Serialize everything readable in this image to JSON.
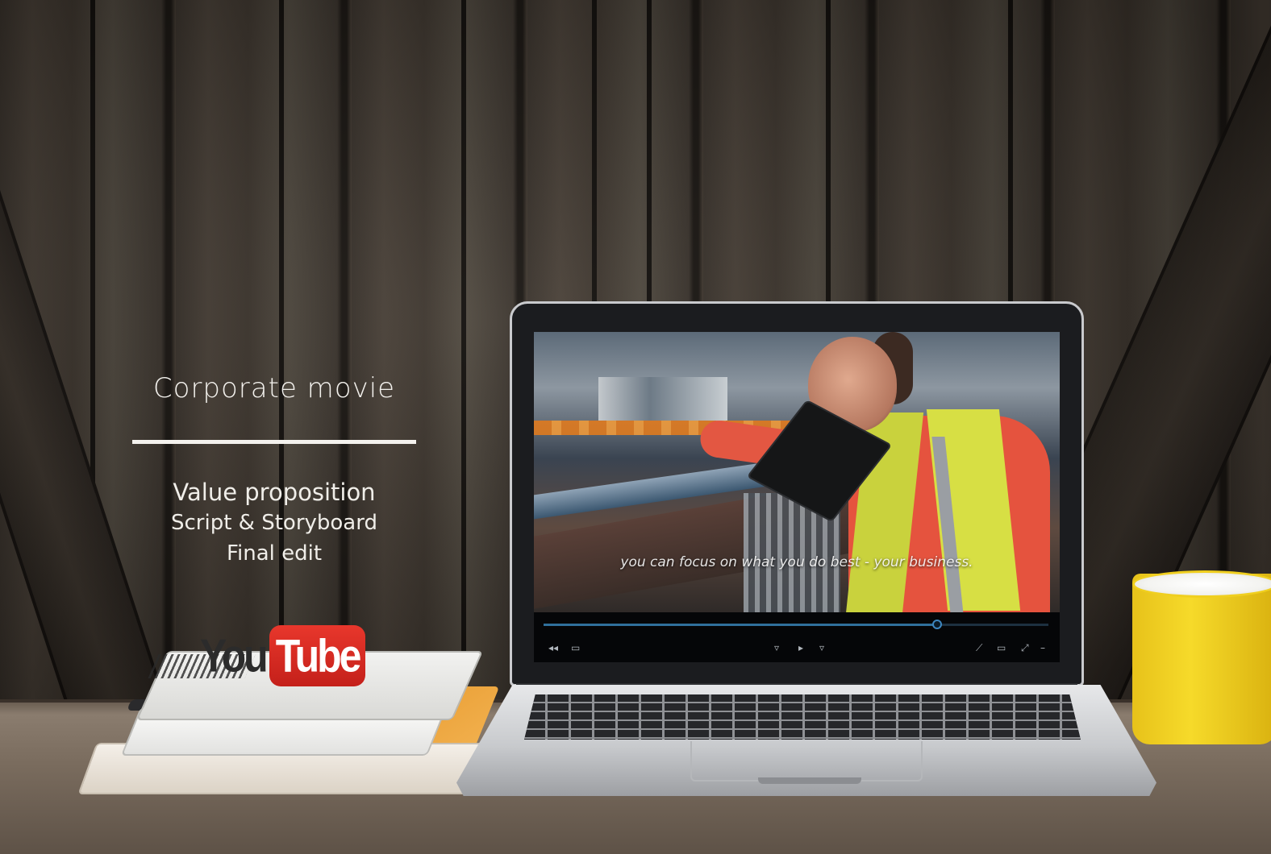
{
  "overlay": {
    "title": "Corporate movie",
    "items": [
      "Value proposition",
      "Script & Storyboard",
      "Final edit"
    ]
  },
  "logo": {
    "you": "You",
    "tube": "Tube"
  },
  "video_player": {
    "caption": "you can focus on what you do best - your business.",
    "progress": 0.78,
    "accent_color": "#2f6f9b"
  },
  "icons": [
    "volume-icon",
    "subtitles-icon",
    "previous-icon",
    "play-icon",
    "next-icon",
    "pencil-icon",
    "screen-icon",
    "fullscreen-icon",
    "more-icon"
  ]
}
